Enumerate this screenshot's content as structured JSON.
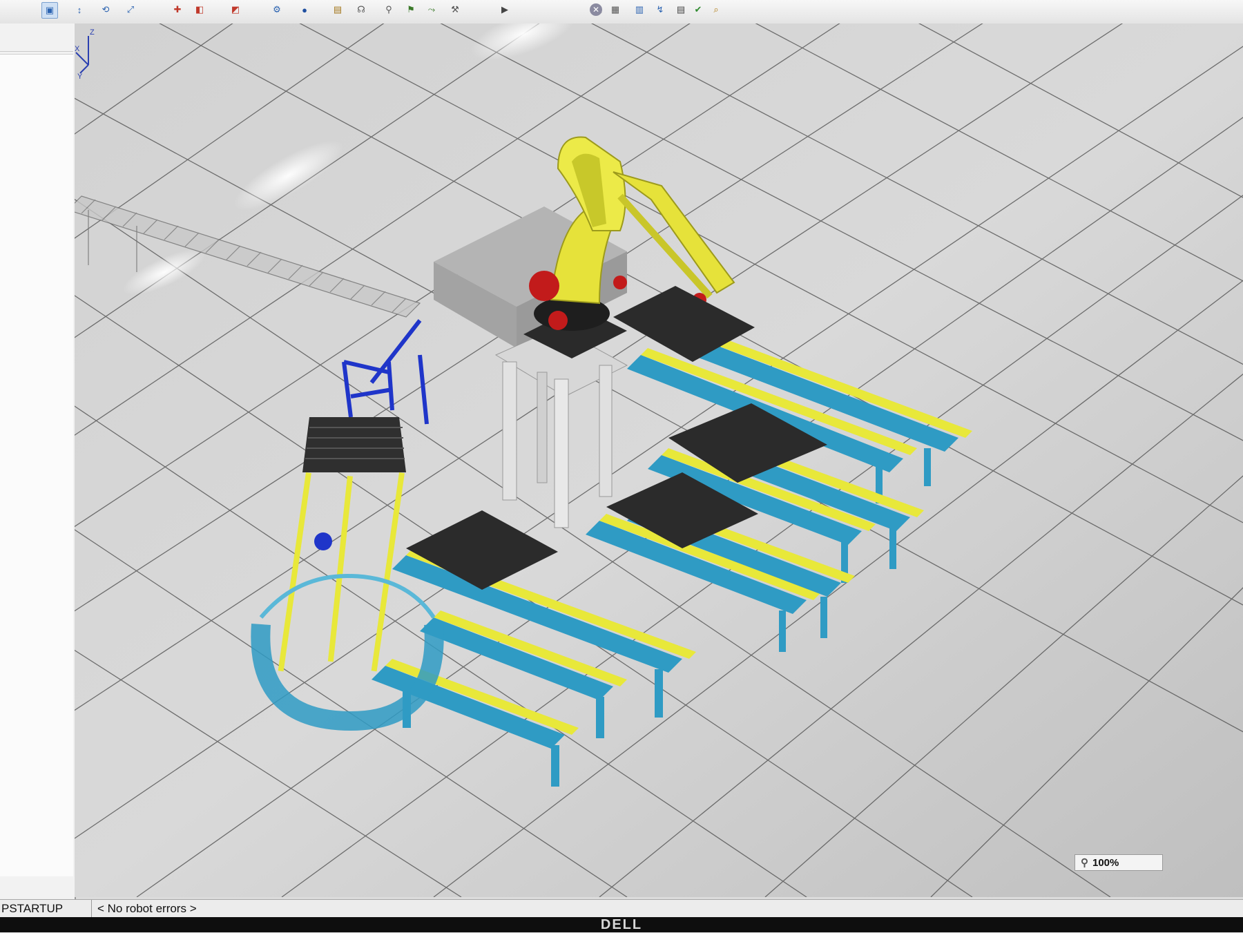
{
  "toolbar": {
    "icons": [
      "select-icon",
      "move-icon",
      "rotate-icon",
      "zoom-icon",
      "record-icon",
      "teach-icon",
      "frame-icon",
      "robot-icon",
      "run-icon",
      "pause-icon",
      "stop-icon",
      "close-icon",
      "layout-icon",
      "tool-icon",
      "measure-icon",
      "camera-icon"
    ]
  },
  "viewport": {
    "zoom_label": "100%",
    "scene": "3D workcell: robot palletizer with conveyors and pallets",
    "axis_labels": {
      "x": "X",
      "y": "Y",
      "z": "Z"
    }
  },
  "status": {
    "mode": "PSTARTUP",
    "message": "< No robot errors >"
  },
  "bezel": {
    "brand": "DELL"
  },
  "colors": {
    "robot": "#e6e23a",
    "conveyor_frame": "#2f9bc4",
    "conveyor_rail": "#e8e83a",
    "pallet": "#2b2b2b",
    "tool_sphere": "#2fd12f"
  }
}
